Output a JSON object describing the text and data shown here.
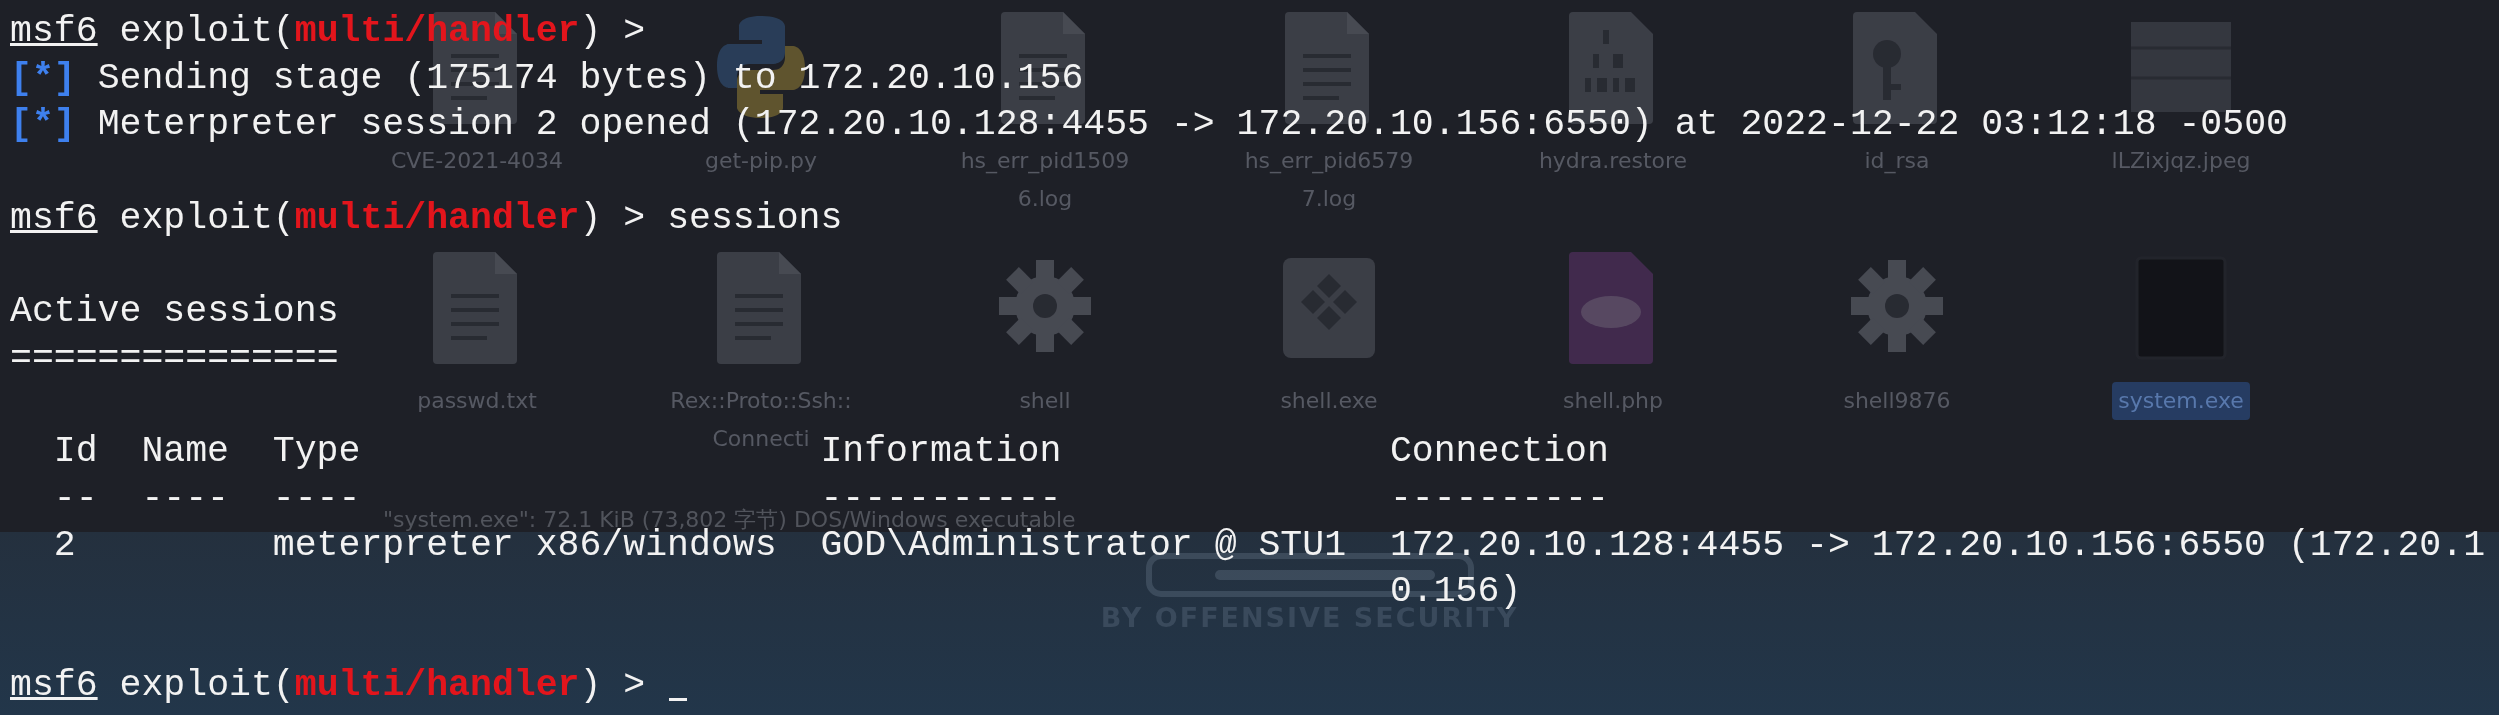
{
  "desktop": {
    "files": [
      {
        "lines": [
          "CVE-2021-4034"
        ],
        "kind": "document",
        "selected": false
      },
      {
        "lines": [
          "get-pip.py"
        ],
        "kind": "python",
        "selected": false
      },
      {
        "lines": [
          "hs_err_pid1509",
          "6.log"
        ],
        "kind": "document",
        "selected": false
      },
      {
        "lines": [
          "hs_err_pid6579",
          "7.log"
        ],
        "kind": "document",
        "selected": false
      },
      {
        "lines": [
          "hydra.restore"
        ],
        "kind": "binary",
        "selected": false
      },
      {
        "lines": [
          "id_rsa"
        ],
        "kind": "key",
        "selected": false
      },
      {
        "lines": [
          "lLZixjqz.jpeg"
        ],
        "kind": "image",
        "selected": false
      },
      {
        "lines": [
          "passwd.txt"
        ],
        "kind": "document",
        "selected": false
      },
      {
        "lines": [
          "Rex::Proto::Ssh::",
          "Connecti"
        ],
        "kind": "document",
        "selected": false
      },
      {
        "lines": [
          "shell"
        ],
        "kind": "gear",
        "selected": false
      },
      {
        "lines": [
          "shell.exe"
        ],
        "kind": "exe",
        "selected": false
      },
      {
        "lines": [
          "shell.php"
        ],
        "kind": "php",
        "selected": false
      },
      {
        "lines": [
          "shell9876"
        ],
        "kind": "gear",
        "selected": false
      },
      {
        "lines": [
          "system.exe"
        ],
        "kind": "blank",
        "selected": true
      }
    ],
    "status": "\"system.exe\": 72.1 KiB (73,802 字节) DOS/Windows executable",
    "wallpaper_text": "BY OFFENSIVE SECURITY"
  },
  "terminal": {
    "lines": [
      {
        "kind": "prompt",
        "name": "msf6",
        "context": "exploit(",
        "module": "multi/handler",
        "suffix": ") >"
      },
      {
        "kind": "status",
        "marker": "[*]",
        "text": "Sending stage (175174 bytes) to 172.20.10.156"
      },
      {
        "kind": "status",
        "marker": "[*]",
        "text": "Meterpreter session 2 opened (172.20.10.128:4455 -> 172.20.10.156:6550) at 2022-12-22 03:12:18 -0500"
      },
      {
        "kind": "blank"
      },
      {
        "kind": "prompt",
        "name": "msf6",
        "context": "exploit(",
        "module": "multi/handler",
        "suffix": ") >",
        "command": "sessions"
      },
      {
        "kind": "blank"
      },
      {
        "kind": "text",
        "text": "Active sessions"
      },
      {
        "kind": "text",
        "text": "==============="
      },
      {
        "kind": "blank"
      },
      {
        "kind": "table",
        "columns": [
          {
            "label": "Id",
            "rule": "--"
          },
          {
            "label": "Name",
            "rule": "----"
          },
          {
            "label": "Type",
            "rule": "----"
          },
          {
            "label": "Information",
            "rule": "-----------"
          },
          {
            "label": "Connection",
            "rule": "----------"
          }
        ],
        "rows": [
          {
            "id": "2",
            "type": "meterpreter x86/windows",
            "information": "GOD\\Administrator @ STU1",
            "connection": "172.20.10.128:4455 -> 172.20.10.156:6550 (172.20.10.156)"
          }
        ]
      },
      {
        "kind": "blank"
      },
      {
        "kind": "prompt",
        "name": "msf6",
        "context": "exploit(",
        "module": "multi/handler",
        "suffix": ") >",
        "cursor": true
      }
    ]
  }
}
